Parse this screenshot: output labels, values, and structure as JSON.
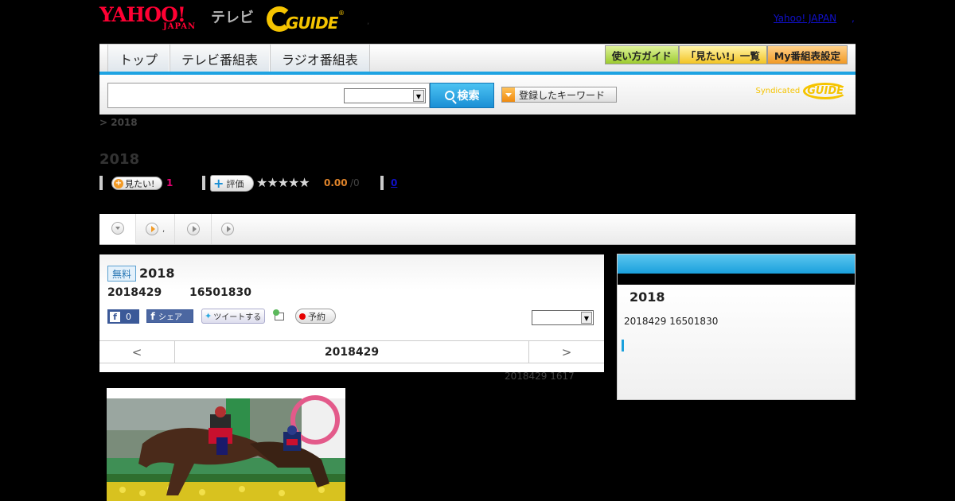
{
  "header": {
    "yahoo_logo": "YAHOO!",
    "yahoo_sub": "JAPAN",
    "tv_label": "テレビ",
    "gguide_logo": "GUIDE",
    "gguide_reg": "®",
    "dot": ",",
    "yahoo_japan_link": "Yahoo! JAPAN",
    "link_comma": ","
  },
  "nav": {
    "tabs": [
      {
        "label": "トップ"
      },
      {
        "label": "テレビ番組表"
      },
      {
        "label": "ラジオ番組表"
      }
    ],
    "right_buttons": [
      {
        "label": "使い方ガイド",
        "color": "#9ccc2e"
      },
      {
        "label": "「見たい!」一覧",
        "color": "#f3c424"
      },
      {
        "label": "My番組表設定",
        "color": "#f29a24"
      }
    ]
  },
  "search": {
    "input_value": "",
    "select_value": "",
    "button_label": "検索",
    "keyword_button_label": "登録したキーワード",
    "syndicated_label": "Syndicated",
    "syndicated_logo": "GUIDE"
  },
  "breadcrumb": "> 2018",
  "page_title": "2018",
  "stats": {
    "mitai_label": "見たい!",
    "mitai_count": "1",
    "hyoka_label": "評価",
    "stars": "★★★★★",
    "score": "0.00",
    "score_count": "/0",
    "link_count": "0"
  },
  "play_tabs": {
    "comma": ","
  },
  "program": {
    "badge": "無料",
    "title": "2018",
    "date": "2018429",
    "time": "16501830",
    "fb_like_count": "0",
    "fb_share_label": "シェア",
    "tweet_label": "ツイートする",
    "yoyaku_label": "予約",
    "select_value": "",
    "nav_prev": "<",
    "nav_current": "2018429",
    "nav_next": ">",
    "broadcast_info": "2018429  1617"
  },
  "side": {
    "title": "2018",
    "date": "2018429  16501830"
  },
  "colors": {
    "accent_blue": "#1ea3e2",
    "yahoo_red": "#ff0033",
    "gguide_yellow": "#f5c400",
    "mitai_pink": "#e60073",
    "score_orange": "#e0842a"
  }
}
